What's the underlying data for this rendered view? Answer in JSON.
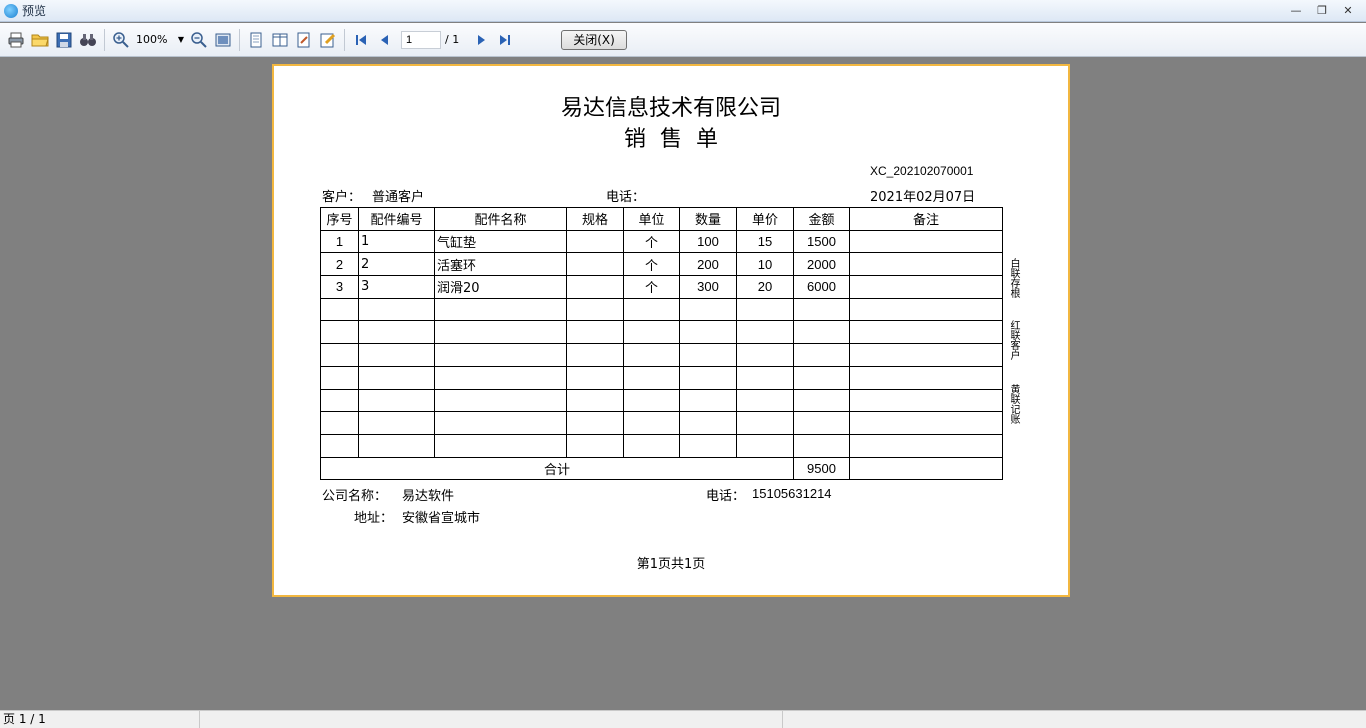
{
  "window": {
    "title": "预览"
  },
  "toolbar": {
    "zoom": "100%",
    "page_current": "1",
    "page_total": "/ 1",
    "close_label": "关闭(X)"
  },
  "report": {
    "company": "易达信息技术有限公司",
    "title": "销售单",
    "order_no": "XC_202102070001",
    "customer_label": "客户：",
    "customer": "普通客户",
    "phone_label": "电话：",
    "phone": "",
    "date": "2021年02月07日",
    "columns": [
      "序号",
      "配件编号",
      "配件名称",
      "规格",
      "单位",
      "数量",
      "单价",
      "金额",
      "备注"
    ],
    "rows": [
      [
        "1",
        "1",
        "气缸垫",
        "",
        "个",
        "100",
        "15",
        "1500",
        ""
      ],
      [
        "2",
        "2",
        "活塞环",
        "",
        "个",
        "200",
        "10",
        "2000",
        ""
      ],
      [
        "3",
        "3",
        "润滑20",
        "",
        "个",
        "300",
        "20",
        "6000",
        ""
      ],
      [
        "",
        "",
        "",
        "",
        "",
        "",
        "",
        "",
        ""
      ],
      [
        "",
        "",
        "",
        "",
        "",
        "",
        "",
        "",
        ""
      ],
      [
        "",
        "",
        "",
        "",
        "",
        "",
        "",
        "",
        ""
      ],
      [
        "",
        "",
        "",
        "",
        "",
        "",
        "",
        "",
        ""
      ],
      [
        "",
        "",
        "",
        "",
        "",
        "",
        "",
        "",
        ""
      ],
      [
        "",
        "",
        "",
        "",
        "",
        "",
        "",
        "",
        ""
      ],
      [
        "",
        "",
        "",
        "",
        "",
        "",
        "",
        "",
        ""
      ]
    ],
    "total_label": "合计",
    "total_amount": "9500",
    "company_name_label": "公司名称：",
    "company_name": "易达软件",
    "company_phone_label": "电话：",
    "company_phone": "15105631214",
    "address_label": "地址：",
    "address": "安徽省宣城市",
    "page_footer": "第1页共1页",
    "side_copies": [
      "白联存根",
      "红联客户",
      "黄联记账"
    ]
  },
  "status": {
    "page": "页 1 / 1"
  },
  "colors": {
    "paper_border": "#f2b740",
    "canvas": "#808080"
  }
}
